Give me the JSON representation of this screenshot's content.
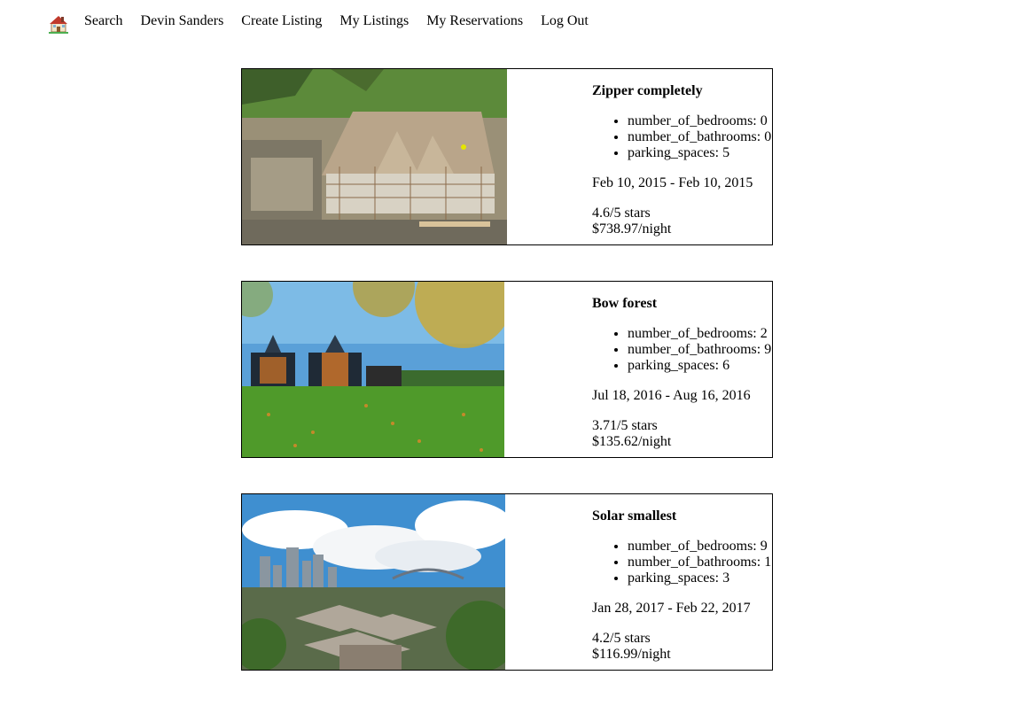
{
  "nav": {
    "home_icon": "house-emoji-icon",
    "links": [
      "Search",
      "Devin Sanders",
      "Create Listing",
      "My Listings",
      "My Reservations",
      "Log Out"
    ]
  },
  "listings": [
    {
      "title": "Zipper completely",
      "photo": "house-under-construction-photo",
      "attributes": [
        "number_of_bedrooms: 0",
        "number_of_bathrooms: 0",
        "parking_spaces: 5"
      ],
      "dates": "Feb 10, 2015 - Feb 10, 2015",
      "rating": "4.6/5 stars",
      "price": "$738.97/night"
    },
    {
      "title": "Bow forest",
      "photo": "modern-barn-houses-photo",
      "attributes": [
        "number_of_bedrooms: 2",
        "number_of_bathrooms: 9",
        "parking_spaces: 6"
      ],
      "dates": "Jul 18, 2016 - Aug 16, 2016",
      "rating": "3.71/5 stars",
      "price": "$135.62/night"
    },
    {
      "title": "Solar smallest",
      "photo": "city-skyline-photo",
      "attributes": [
        "number_of_bedrooms: 9",
        "number_of_bathrooms: 1",
        "parking_spaces: 3"
      ],
      "dates": "Jan 28, 2017 - Feb 22, 2017",
      "rating": "4.2/5 stars",
      "price": "$116.99/night"
    }
  ]
}
